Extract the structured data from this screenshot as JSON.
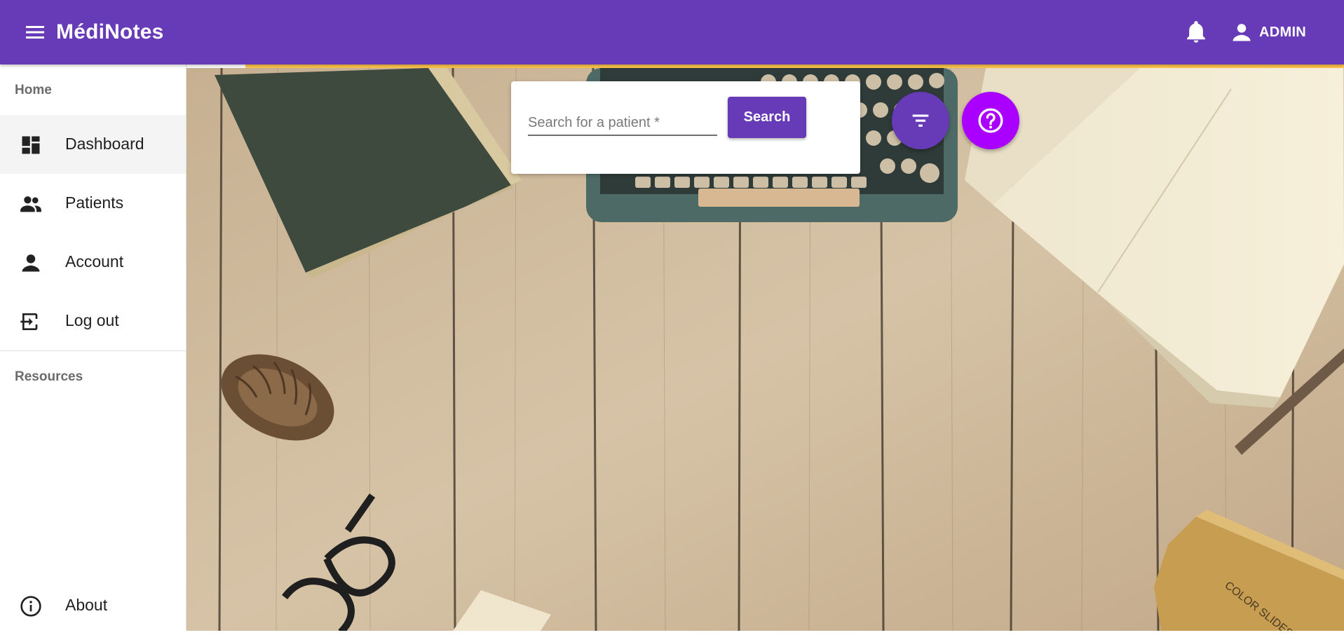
{
  "app": {
    "title": "MédiNotes"
  },
  "header": {
    "user_label": "ADMIN"
  },
  "sidebar": {
    "sections": [
      {
        "header": "Home"
      },
      {
        "header": "Resources"
      }
    ],
    "items": [
      {
        "label": "Dashboard",
        "icon": "dashboard-icon",
        "active": true
      },
      {
        "label": "Patients",
        "icon": "people-icon"
      },
      {
        "label": "Account",
        "icon": "person-icon"
      },
      {
        "label": "Log out",
        "icon": "exit-icon"
      }
    ],
    "footer_item": {
      "label": "About",
      "icon": "info-icon"
    }
  },
  "search": {
    "placeholder": "Search for a patient *",
    "button_label": "Search"
  },
  "scene": {
    "slides_box_text": "COLOR SLIDES"
  },
  "colors": {
    "primary": "#673ab7",
    "accent": "#ffc64a",
    "help_fab": "#aa00ff"
  }
}
